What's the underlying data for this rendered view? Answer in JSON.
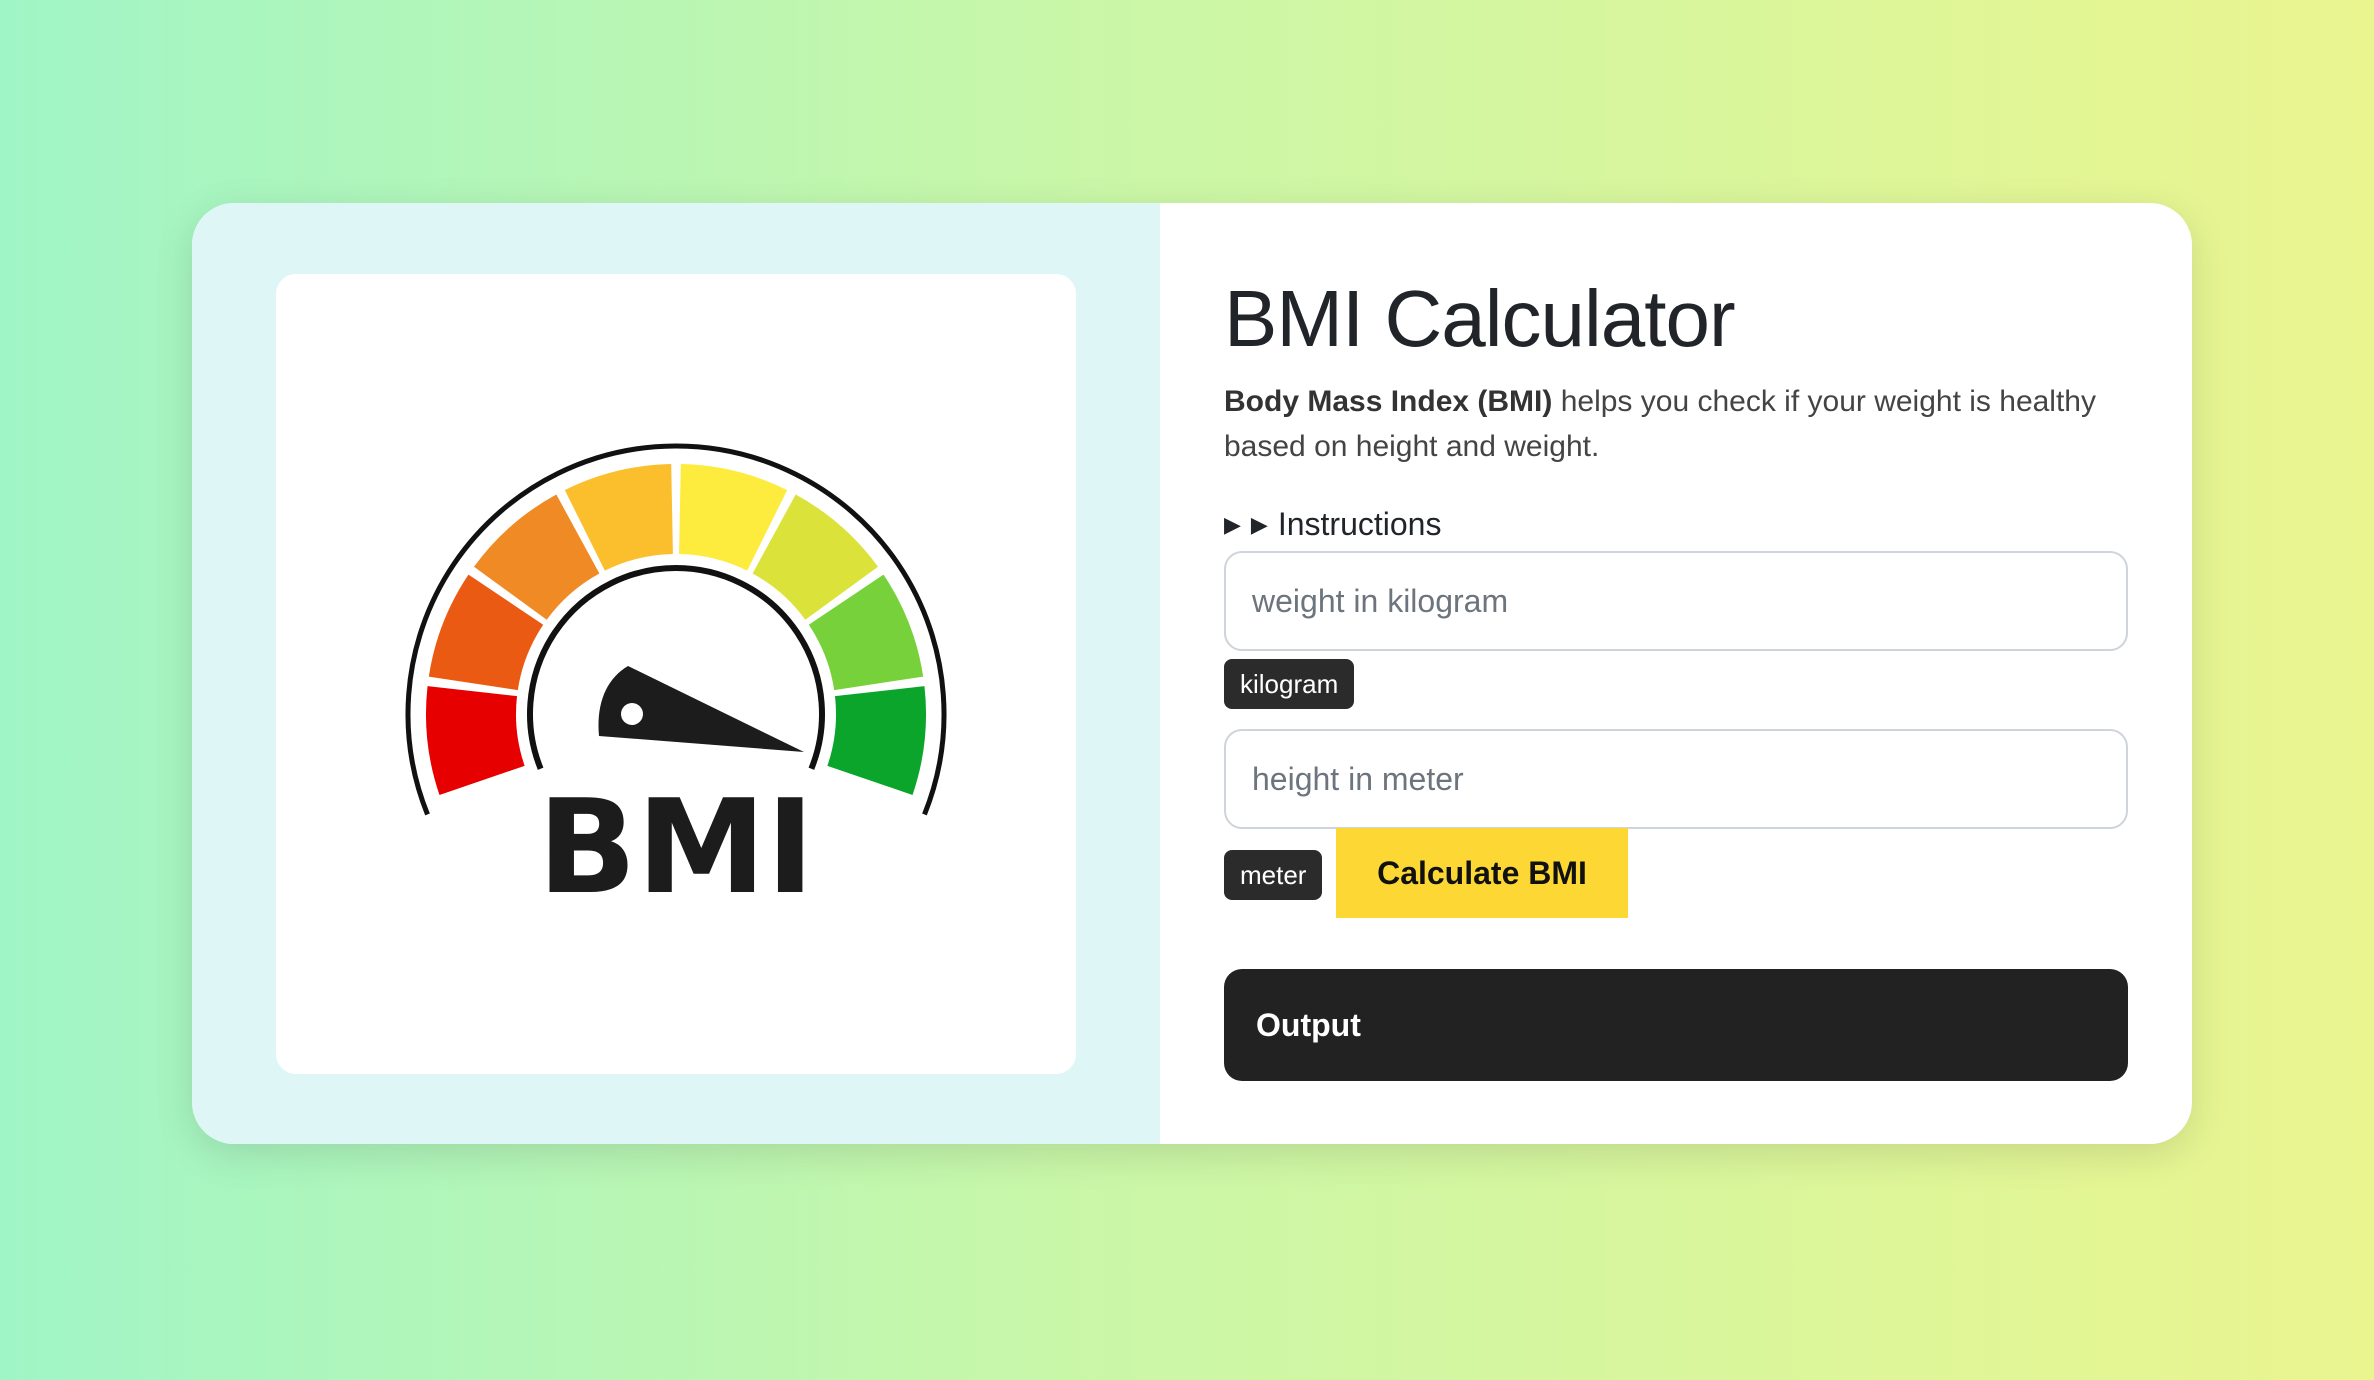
{
  "title": "BMI Calculator",
  "description": {
    "bold": "Body Mass Index (BMI)",
    "rest": " helps you check if your weight is healthy based on height and weight."
  },
  "instructions": {
    "marker1": "▶",
    "marker2": "▶",
    "label": "Instructions"
  },
  "weight": {
    "placeholder": "weight in kilogram",
    "value": "",
    "unit": "kilogram"
  },
  "height": {
    "placeholder": "height in meter",
    "value": "",
    "unit": "meter"
  },
  "calculate_label": "Calculate BMI",
  "output_label": "Output",
  "gauge": {
    "text": "BMI",
    "segment_colors": [
      "#e60000",
      "#ea5a12",
      "#f08a24",
      "#fbbf2d",
      "#fdeb3d",
      "#dbe23a",
      "#76d13a",
      "#0aa52a"
    ]
  },
  "colors": {
    "accent_button": "#fdd835",
    "output_bg": "#222222",
    "badge_bg": "#2b2b2b",
    "left_panel_bg": "#dff6f7"
  }
}
